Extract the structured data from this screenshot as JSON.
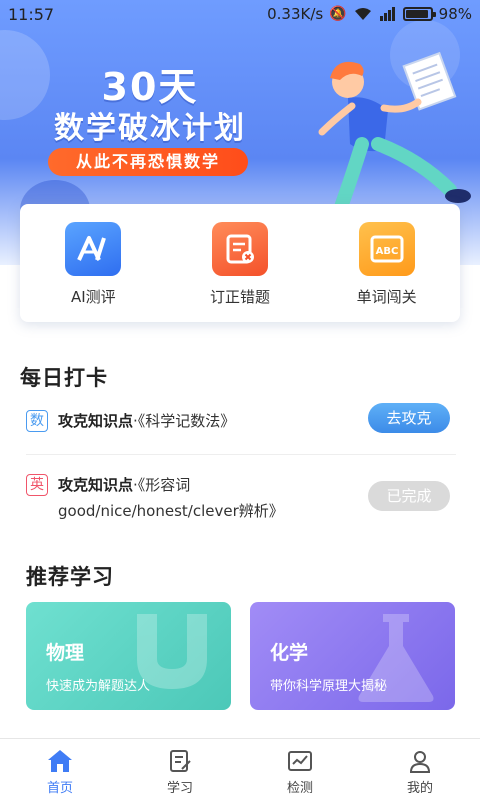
{
  "status_bar": {
    "time": "11:57",
    "network_speed": "0.33K/s",
    "battery_percent": "98%",
    "battery_level": 0.98
  },
  "banner": {
    "title_line1": "30天",
    "title_line2": "数学破冰计划",
    "tagline": "从此不再恐惧数学"
  },
  "quick_entries": [
    {
      "label": "AI测评",
      "icon": "ai-assessment-icon",
      "color": "#3d86f5"
    },
    {
      "label": "订正错题",
      "icon": "mistake-correction-icon",
      "color": "#ff6b3d"
    },
    {
      "label": "单词闯关",
      "icon": "word-challenge-icon",
      "color": "#ffa928"
    }
  ],
  "daily_checkin": {
    "title": "每日打卡",
    "tasks": [
      {
        "badge": "数",
        "prefix": "攻克知识点",
        "text": "·《科学记数法》",
        "button": "去攻克",
        "status": "pending"
      },
      {
        "badge": "英",
        "prefix": "攻克知识点",
        "text": "·《形容词good/nice/honest/clever辨析》",
        "button": "已完成",
        "status": "done"
      }
    ]
  },
  "recommend": {
    "title": "推荐学习",
    "cards": [
      {
        "title": "物理",
        "subtitle": "快速成为解题达人",
        "color": "#5ed6c6"
      },
      {
        "title": "化学",
        "subtitle": "带你科学原理大揭秘",
        "color": "#8f7cf0"
      }
    ]
  },
  "tab_bar": {
    "items": [
      {
        "label": "首页",
        "icon": "home-icon",
        "active": true
      },
      {
        "label": "学习",
        "icon": "study-icon",
        "active": false
      },
      {
        "label": "检测",
        "icon": "test-icon",
        "active": false
      },
      {
        "label": "我的",
        "icon": "profile-icon",
        "active": false
      }
    ]
  },
  "colors": {
    "accent": "#3f7cf5",
    "banner_blue": "#5b86f3",
    "pending_button": "#4a9bf0",
    "done_button": "#d9d9d9"
  }
}
